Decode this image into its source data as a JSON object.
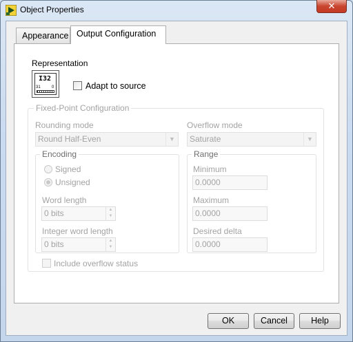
{
  "window": {
    "title": "Object Properties",
    "close_glyph": "✕"
  },
  "tabs": [
    {
      "label": "Appearance",
      "active": false
    },
    {
      "label": "Output Configuration",
      "active": true
    }
  ],
  "representation": {
    "label": "Representation",
    "icon_text": "I32",
    "icon_sub_left": "31",
    "icon_sub_right": "0",
    "adapt_label": "Adapt to source"
  },
  "fixed_point": {
    "group_label": "Fixed-Point Configuration",
    "rounding_label": "Rounding mode",
    "rounding_value": "Round Half-Even",
    "overflow_label": "Overflow mode",
    "overflow_value": "Saturate",
    "encoding": {
      "label": "Encoding",
      "signed": "Signed",
      "unsigned": "Unsigned",
      "word_length_label": "Word length",
      "word_length_value": "0 bits",
      "integer_word_length_label": "Integer word length",
      "integer_word_length_value": "0 bits"
    },
    "range": {
      "label": "Range",
      "minimum_label": "Minimum",
      "minimum_value": "0.0000",
      "maximum_label": "Maximum",
      "maximum_value": "0.0000",
      "delta_label": "Desired delta",
      "delta_value": "0.0000"
    },
    "overflow_status_label": "Include overflow status"
  },
  "buttons": {
    "ok": "OK",
    "cancel": "Cancel",
    "help": "Help"
  },
  "colors": {
    "close_button": "#c53a24",
    "disabled_text": "#a3a3a3"
  }
}
